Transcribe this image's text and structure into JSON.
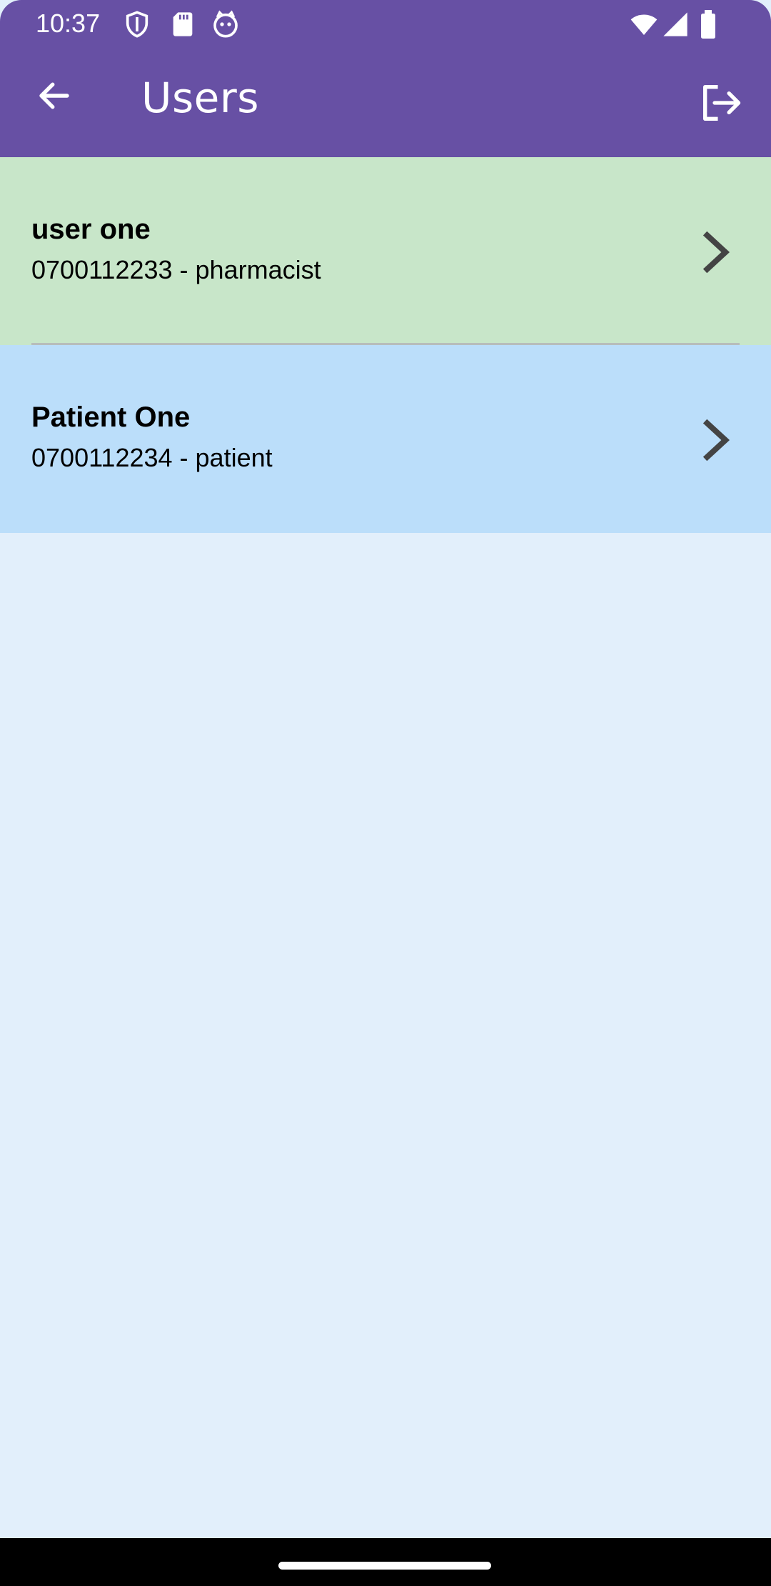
{
  "status_bar": {
    "time": "10:37",
    "icons_left": [
      "shield-icon",
      "sd-card-icon",
      "cat-face-icon"
    ],
    "icons_right": [
      "wifi-icon",
      "signal-icon",
      "battery-icon"
    ]
  },
  "toolbar": {
    "title": "Users",
    "back_icon": "arrow-left-icon",
    "logout_icon": "logout-icon"
  },
  "users": [
    {
      "name": "user one",
      "detail": "0700112233 - pharmacist",
      "background": "#c8e6c9"
    },
    {
      "name": "Patient One",
      "detail": "0700112234 - patient",
      "background": "#bbdefa"
    }
  ],
  "colors": {
    "header": "#6750a4",
    "screen_background": "#e2effb",
    "chevron": "#444444"
  }
}
